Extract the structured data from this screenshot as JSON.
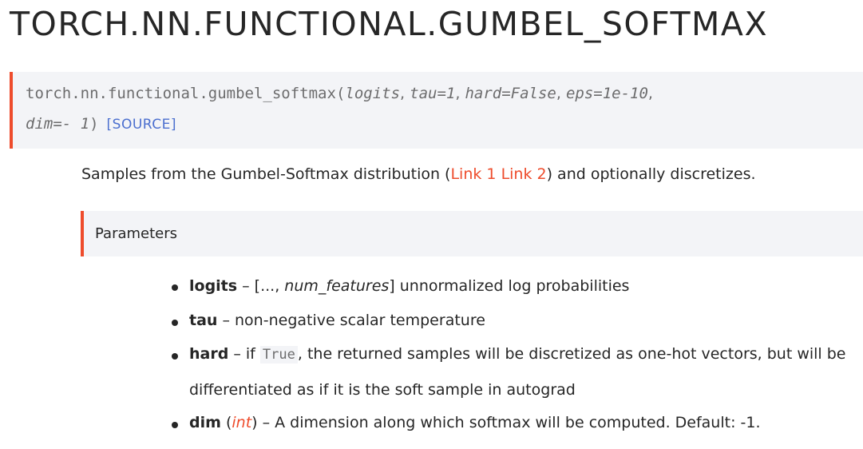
{
  "page": {
    "title": "TORCH.NN.FUNCTIONAL.GUMBEL_SOFTMAX"
  },
  "signature": {
    "function_name": "torch.nn.functional.gumbel_softmax",
    "open_paren": "(",
    "params": [
      {
        "name": "logits",
        "default": ""
      },
      {
        "name": "tau",
        "default": "=1"
      },
      {
        "name": "hard",
        "default": "=False"
      },
      {
        "name": "eps",
        "default": "=1e-10"
      },
      {
        "name": "dim",
        "default": "=- 1"
      }
    ],
    "close_paren": ")",
    "source_link": "[SOURCE]"
  },
  "description": {
    "before": "Samples from the Gumbel-Softmax distribution (",
    "link1": "Link 1",
    "space": " ",
    "link2": "Link 2",
    "after": ") and optionally discretizes."
  },
  "parameters": {
    "heading": "Parameters",
    "items": [
      {
        "name": "logits",
        "dash": " – [...,",
        "shape": "num_features",
        "rest": "] unnormalized log probabilities"
      },
      {
        "name": "tau",
        "rest": " – non-negative scalar temperature"
      },
      {
        "name": "hard",
        "dash": " – if ",
        "code": "True",
        "rest": ", the returned samples will be discretized as one-hot vectors, but will be",
        "line2": "differentiated as if it is the soft sample in autograd"
      },
      {
        "name": "dim",
        "open": " (",
        "type": "int",
        "rest": ") – A dimension along which softmax will be computed. Default: -1."
      }
    ]
  }
}
